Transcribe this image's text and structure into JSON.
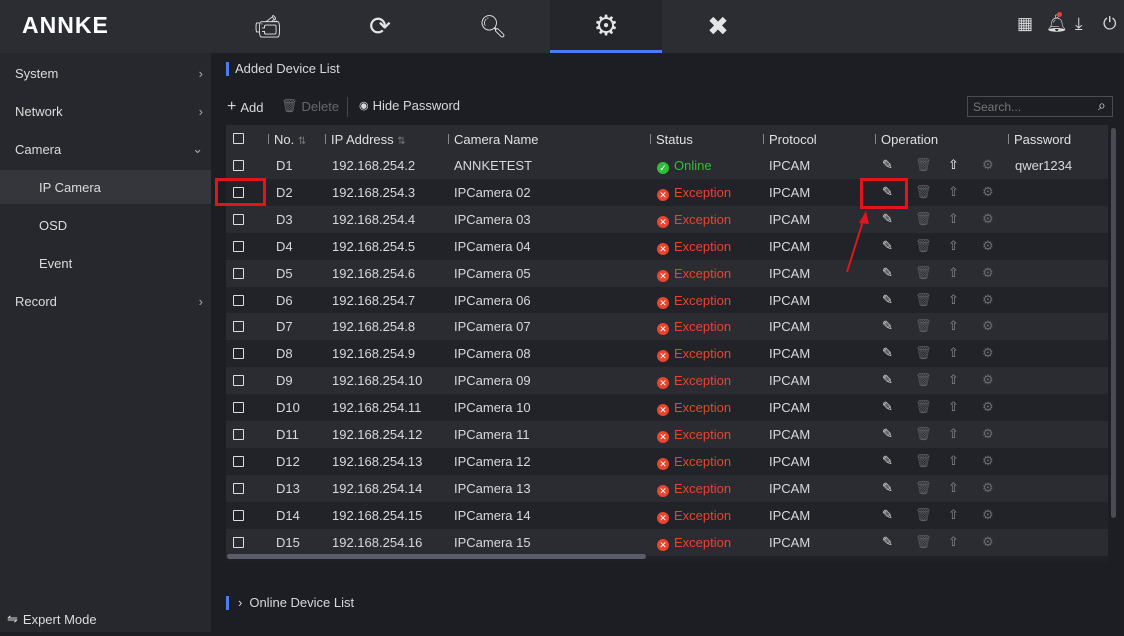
{
  "brand": "ANNKE",
  "topnav": [
    {
      "icon": "camera-icon"
    },
    {
      "icon": "playback-icon"
    },
    {
      "icon": "search-file-icon"
    },
    {
      "icon": "gear-icon",
      "active": true
    },
    {
      "icon": "tools-icon"
    }
  ],
  "top_icons": [
    "qr-code-icon",
    "bell-icon",
    "download-icon",
    "power-icon"
  ],
  "sidebar": {
    "items": [
      {
        "label": "System"
      },
      {
        "label": "Network"
      },
      {
        "label": "Camera"
      },
      {
        "label": "IP Camera"
      },
      {
        "label": "OSD"
      },
      {
        "label": "Event"
      },
      {
        "label": "Record"
      }
    ],
    "expert_mode": "Expert Mode"
  },
  "main": {
    "section_title": "Added Device List",
    "add": "Add",
    "delete": "Delete",
    "hide_password": "Hide Password",
    "search_placeholder": "Search...",
    "online_list": "Online Device List"
  },
  "table": {
    "headers": {
      "no": "No.",
      "ip": "IP Address",
      "name": "Camera Name",
      "status": "Status",
      "protocol": "Protocol",
      "operation": "Operation",
      "password": "Password"
    },
    "rows": [
      {
        "no": "D1",
        "ip": "192.168.254.2",
        "name": "ANNKETEST",
        "status": "Online",
        "protocol": "IPCAM",
        "password": "qwer1234"
      },
      {
        "no": "D2",
        "ip": "192.168.254.3",
        "name": "IPCamera 02",
        "status": "Exception",
        "protocol": "IPCAM",
        "password": ""
      },
      {
        "no": "D3",
        "ip": "192.168.254.4",
        "name": "IPCamera 03",
        "status": "Exception",
        "protocol": "IPCAM",
        "password": ""
      },
      {
        "no": "D4",
        "ip": "192.168.254.5",
        "name": "IPCamera 04",
        "status": "Exception",
        "protocol": "IPCAM",
        "password": ""
      },
      {
        "no": "D5",
        "ip": "192.168.254.6",
        "name": "IPCamera 05",
        "status": "Exception",
        "protocol": "IPCAM",
        "password": ""
      },
      {
        "no": "D6",
        "ip": "192.168.254.7",
        "name": "IPCamera 06",
        "status": "Exception",
        "protocol": "IPCAM",
        "password": ""
      },
      {
        "no": "D7",
        "ip": "192.168.254.8",
        "name": "IPCamera 07",
        "status": "Exception",
        "protocol": "IPCAM",
        "password": ""
      },
      {
        "no": "D8",
        "ip": "192.168.254.9",
        "name": "IPCamera 08",
        "status": "Exception",
        "protocol": "IPCAM",
        "password": ""
      },
      {
        "no": "D9",
        "ip": "192.168.254.10",
        "name": "IPCamera 09",
        "status": "Exception",
        "protocol": "IPCAM",
        "password": ""
      },
      {
        "no": "D10",
        "ip": "192.168.254.11",
        "name": "IPCamera 10",
        "status": "Exception",
        "protocol": "IPCAM",
        "password": ""
      },
      {
        "no": "D11",
        "ip": "192.168.254.12",
        "name": "IPCamera 11",
        "status": "Exception",
        "protocol": "IPCAM",
        "password": ""
      },
      {
        "no": "D12",
        "ip": "192.168.254.13",
        "name": "IPCamera 12",
        "status": "Exception",
        "protocol": "IPCAM",
        "password": ""
      },
      {
        "no": "D13",
        "ip": "192.168.254.14",
        "name": "IPCamera 13",
        "status": "Exception",
        "protocol": "IPCAM",
        "password": ""
      },
      {
        "no": "D14",
        "ip": "192.168.254.15",
        "name": "IPCamera 14",
        "status": "Exception",
        "protocol": "IPCAM",
        "password": ""
      },
      {
        "no": "D15",
        "ip": "192.168.254.16",
        "name": "IPCamera 15",
        "status": "Exception",
        "protocol": "IPCAM",
        "password": ""
      }
    ]
  },
  "colors": {
    "accent": "#4d7cf0",
    "online": "#2fbf3a",
    "exception": "#e8442e",
    "annotation": "#e0161c"
  }
}
